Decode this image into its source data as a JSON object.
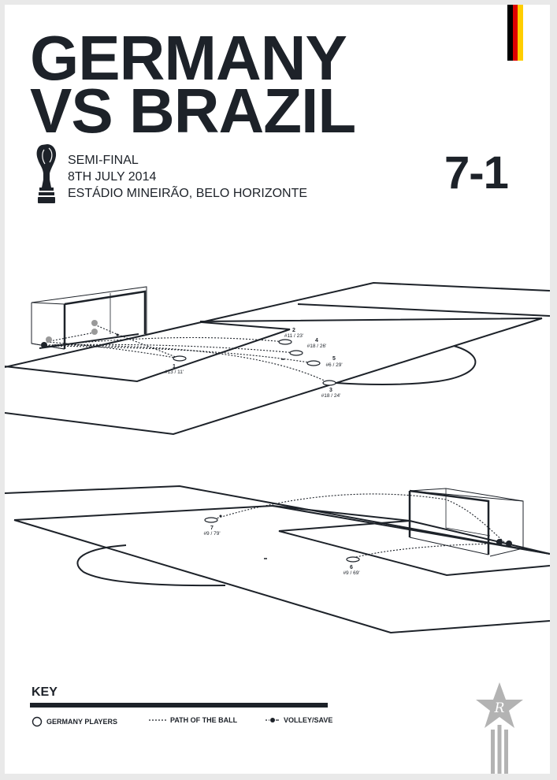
{
  "header": {
    "title_line1": "GERMANY",
    "title_line2": "VS BRAZIL",
    "stage": "SEMI-FINAL",
    "date": "8TH JULY 2014",
    "venue": "ESTÁDIO MINEIRÃO, BELO HORIZONTE",
    "score": "7-1"
  },
  "flag_colors": [
    "#000000",
    "#dd0000",
    "#ffce00"
  ],
  "icons": {
    "trophy": "world-cup-trophy-icon",
    "logo": "star-r-logo-icon"
  },
  "goals_top": [
    {
      "number": "1",
      "detail": "#13 / 11'"
    },
    {
      "number": "2",
      "detail": "#11 / 23'"
    },
    {
      "number": "3",
      "detail": "#18 / 24'"
    },
    {
      "number": "4",
      "detail": "#18 / 26'"
    },
    {
      "number": "5",
      "detail": "#6 / 29'"
    }
  ],
  "goals_bottom": [
    {
      "number": "6",
      "detail": "#9 / 69'"
    },
    {
      "number": "7",
      "detail": "#9 / 79'"
    }
  ],
  "key": {
    "title": "KEY",
    "players": "GERMANY PLAYERS",
    "path": "PATH OF THE BALL",
    "volley": "VOLLEY/SAVE"
  },
  "colors": {
    "ink": "#1d2229",
    "logo_grey": "#b3b3b3",
    "background": "#ffffff"
  }
}
